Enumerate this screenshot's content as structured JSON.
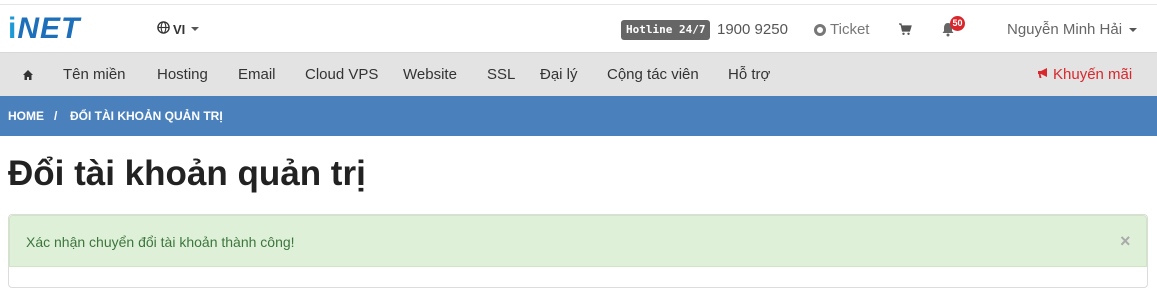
{
  "header": {
    "logo_i": "i",
    "logo_net": "NET",
    "language": "VI",
    "hotline_label": "Hotline 24/7",
    "hotline_number": "1900 9250",
    "ticket_label": "Ticket",
    "notification_count": "50",
    "user_name": "Nguyễn Minh Hải"
  },
  "nav": {
    "items": [
      "Tên miền",
      "Hosting",
      "Email",
      "Cloud VPS",
      "Website",
      "SSL",
      "Đại lý",
      "Cộng tác viên",
      "Hỗ trợ"
    ],
    "promo": "Khuyến mãi"
  },
  "breadcrumb": {
    "home": "HOME",
    "separator": "/",
    "current": "ĐỔI TÀI KHOẢN QUẢN TRỊ"
  },
  "page": {
    "title": "Đổi tài khoản quản trị"
  },
  "alert": {
    "message": "Xác nhận chuyển đổi tài khoản thành công!",
    "close": "×"
  },
  "colors": {
    "brand_blue": "#1c6fb8",
    "breadcrumb_bg": "#4a81bd",
    "promo_red": "#d9282d",
    "success_bg": "#dff0d8",
    "success_text": "#3c763d"
  },
  "icons": {
    "language": "globe-icon",
    "ticket": "lifebuoy-icon",
    "cart": "shopping-cart-icon",
    "notifications": "bell-icon",
    "home": "home-icon",
    "promo": "bullhorn-icon"
  }
}
